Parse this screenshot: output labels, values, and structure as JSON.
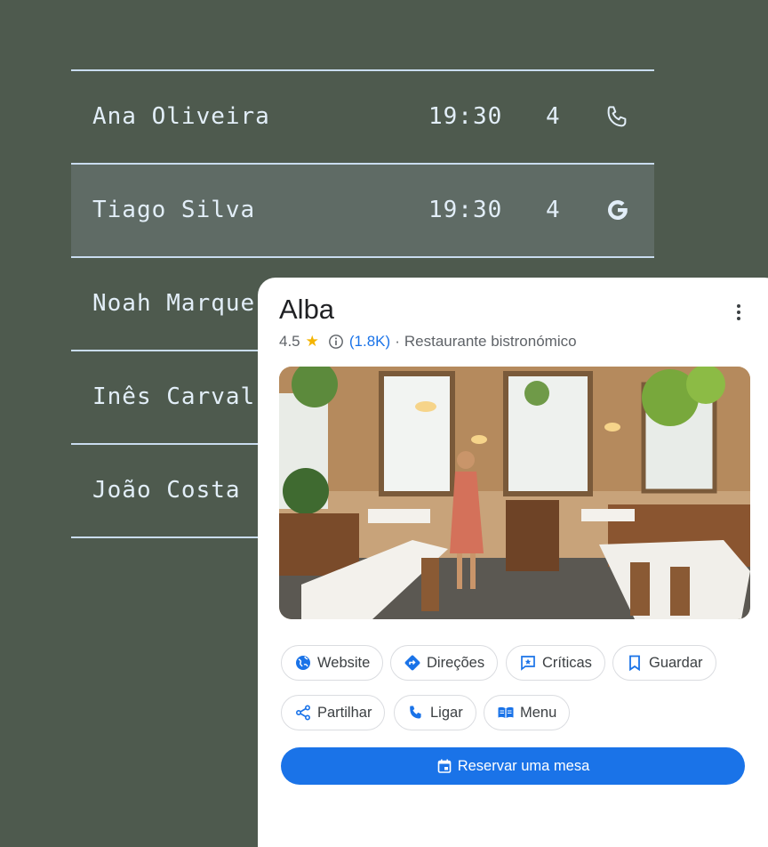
{
  "reservations": [
    {
      "name": "Ana Oliveira",
      "time": "19:30",
      "party": "4",
      "source_icon": "phone-icon"
    },
    {
      "name": "Tiago Silva",
      "time": "19:30",
      "party": "4",
      "source_icon": "google-icon",
      "highlighted": true
    },
    {
      "name": "Noah Marque",
      "time": "",
      "party": "",
      "source_icon": ""
    },
    {
      "name": "Inês Carval",
      "time": "",
      "party": "",
      "source_icon": ""
    },
    {
      "name": "João Costa",
      "time": "",
      "party": "",
      "source_icon": ""
    }
  ],
  "place": {
    "name": "Alba",
    "rating": "4.5",
    "reviews": "(1.8K)",
    "separator": "·",
    "category": "Restaurante bistronómico",
    "photo_alt": "restaurant-interior-photo"
  },
  "actions": {
    "website": "Website",
    "directions": "Direções",
    "reviews": "Críticas",
    "save": "Guardar",
    "share": "Partilhar",
    "call": "Ligar",
    "menu": "Menu",
    "reserve": "Reservar uma mesa"
  },
  "colors": {
    "background": "#4e5a4e",
    "list_text": "#e2eef8",
    "highlight_row": "#5f6b65",
    "accent_blue": "#1a73e8",
    "star": "#f4b400"
  }
}
